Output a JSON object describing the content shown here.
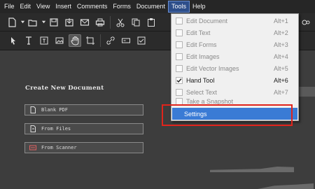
{
  "menubar": {
    "items": [
      "File",
      "Edit",
      "View",
      "Insert",
      "Comments",
      "Forms",
      "Document",
      "Tools",
      "Help"
    ],
    "active": "Tools"
  },
  "toolbar1": {
    "icons": [
      "new-document-icon",
      "dropdown-icon",
      "open-folder-icon",
      "save-icon",
      "export-icon",
      "email-icon",
      "print-icon",
      "cut-icon",
      "copy-icon",
      "paste-icon"
    ]
  },
  "toolbar2": {
    "icons": [
      "select-arrow-icon",
      "text-select-icon",
      "text-box-icon",
      "hand-tool-icon",
      "crop-icon",
      "link-icon",
      "form-field-icon",
      "checkbox-tool-icon"
    ]
  },
  "start_panel": {
    "heading": "Create New Document",
    "buttons": [
      {
        "label": "Blank PDF",
        "icon": "page-icon"
      },
      {
        "label": "From Files",
        "icon": "file-import-icon"
      },
      {
        "label": "From Scanner",
        "icon": "scanner-icon"
      }
    ]
  },
  "tools_menu": {
    "items": [
      {
        "label": "Edit Document",
        "shortcut": "Alt+1",
        "checked": false,
        "enabled": false
      },
      {
        "label": "Edit Text",
        "shortcut": "Alt+2",
        "checked": false,
        "enabled": false
      },
      {
        "label": "Edit Forms",
        "shortcut": "Alt+3",
        "checked": false,
        "enabled": false
      },
      {
        "label": "Edit Images",
        "shortcut": "Alt+4",
        "checked": false,
        "enabled": false
      },
      {
        "label": "Edit Vector Images",
        "shortcut": "Alt+5",
        "checked": false,
        "enabled": false
      },
      {
        "label": "Hand Tool",
        "shortcut": "Alt+6",
        "checked": true,
        "enabled": true
      },
      {
        "label": "Select Text",
        "shortcut": "Alt+7",
        "checked": false,
        "enabled": false
      },
      {
        "label": "Take a Snapshot",
        "shortcut": "",
        "checked": false,
        "enabled": false
      }
    ],
    "selected_item": "Settings"
  },
  "colors": {
    "menu_highlight": "#3a7bd5",
    "annotation_box": "#e0241c"
  }
}
